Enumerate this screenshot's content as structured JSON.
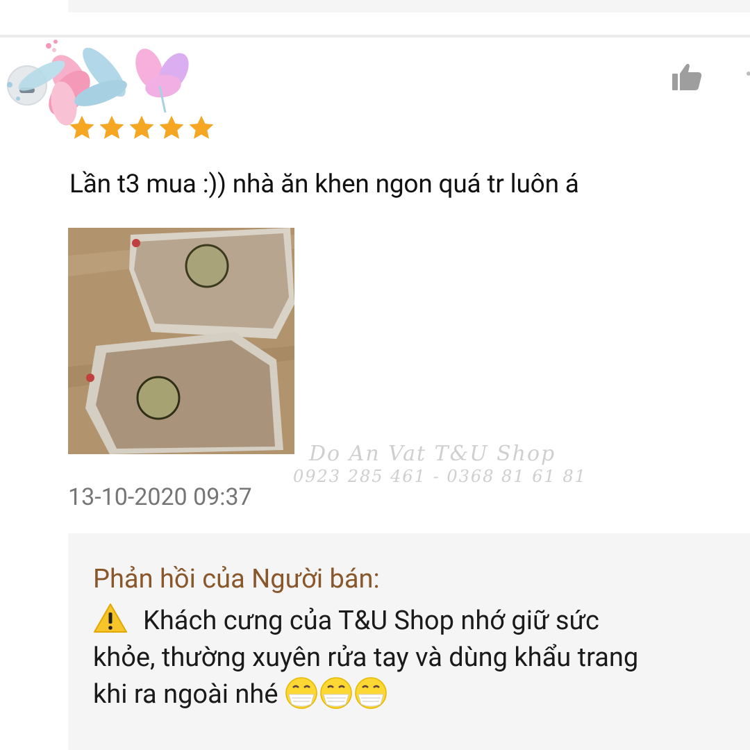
{
  "review": {
    "rating": 5,
    "text": "Lần t3 mua :)) nhà ăn khen ngon quá tr luôn á",
    "timestamp": "13-10-2020 09:37",
    "like_icon": "thumbs-up-icon",
    "more_icon": "more-vertical-icon"
  },
  "watermark": {
    "line1": "Do An Vat T&U Shop",
    "line2": "0923 285 461 - 0368 81 61 81"
  },
  "seller_reply": {
    "title": "Phản hồi của Người bán:",
    "line1": "Khách cưng của T&U Shop nhớ giữ sức",
    "line2": "khỏe, thường xuyên rửa tay và dùng khẩu trang",
    "line3": "khi ra ngoài nhé",
    "warning_icon": "warning-icon",
    "emoji_icon": "face-with-mask-icon"
  },
  "colors": {
    "star": "#f5a623",
    "reply_title": "#8a572a",
    "reply_bg": "#f5f5f5",
    "timestamp": "#757575"
  }
}
